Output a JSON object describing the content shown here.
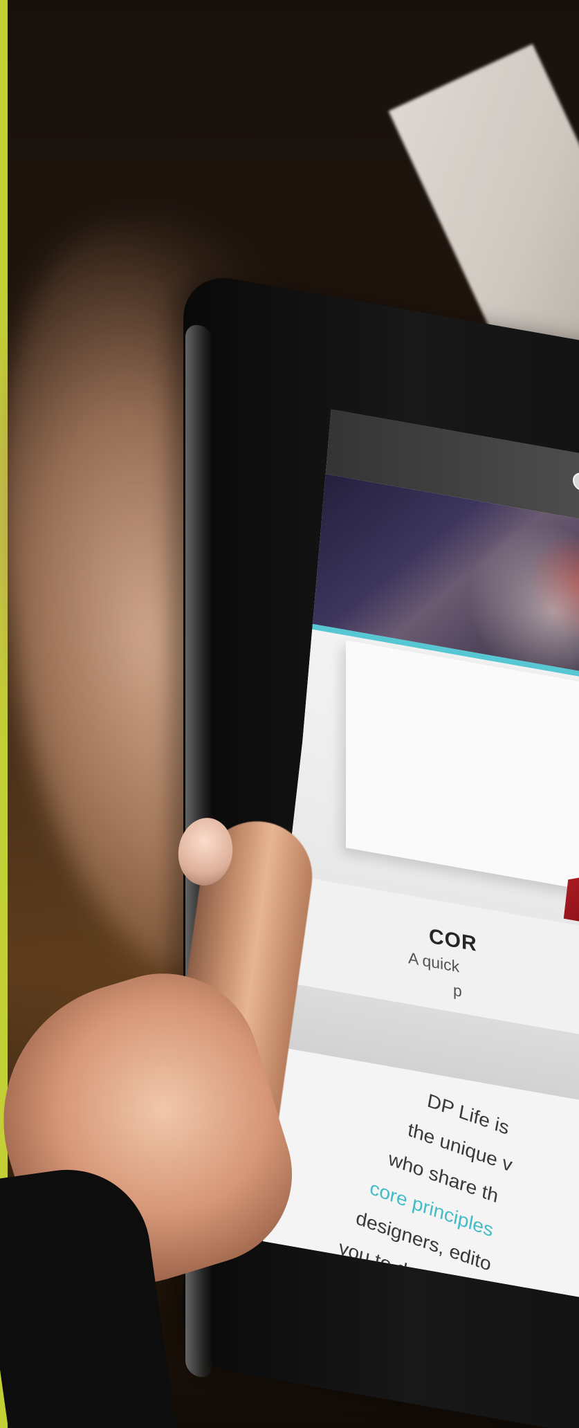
{
  "screen": {
    "card": {
      "title": "COR",
      "subtitle_line_1": "A quick",
      "subtitle_line_2": "p"
    },
    "body_text": [
      "DP Life is",
      "the unique v",
      "who share th",
      "core principles",
      "designers, edito",
      "you to do the san"
    ]
  },
  "colors": {
    "accent_bar": "#c2cf35",
    "hero_rule": "#57c7d3",
    "link": "#46bcc6",
    "red_graphic": "#b31f26"
  },
  "icons": [
    "logo-icon"
  ]
}
